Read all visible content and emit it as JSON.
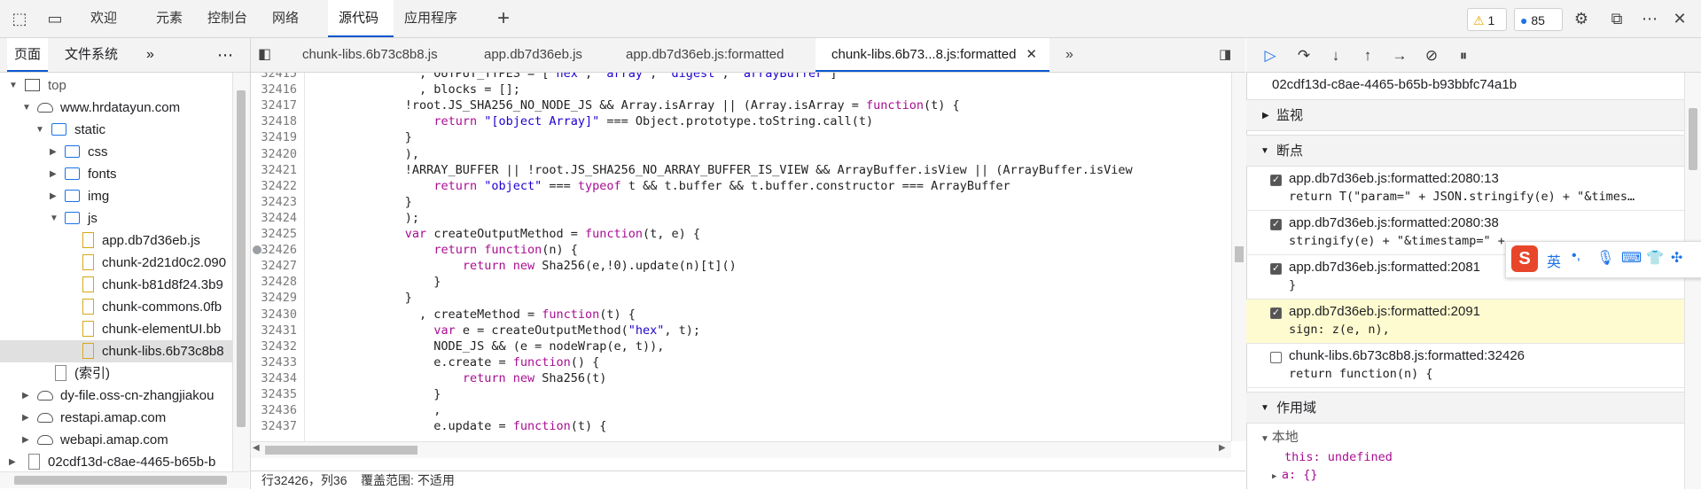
{
  "toolbar": {
    "tabs": [
      "欢迎",
      "元素",
      "控制台",
      "网络",
      "源代码",
      "应用程序"
    ],
    "active_tab": "源代码",
    "warnings_count": "1",
    "messages_count": "85"
  },
  "navigator": {
    "tabs": [
      "页面",
      "文件系统"
    ],
    "tree": [
      {
        "label": "top",
        "icon": "frame-icon"
      },
      {
        "label": "www.hrdatayun.com",
        "icon": "cloud-icon"
      },
      {
        "label": "static",
        "icon": "folder-icon"
      },
      {
        "label": "css",
        "icon": "folder-icon"
      },
      {
        "label": "fonts",
        "icon": "folder-icon"
      },
      {
        "label": "img",
        "icon": "folder-icon"
      },
      {
        "label": "js",
        "icon": "folder-icon"
      },
      {
        "label": "app.db7d36eb.js",
        "icon": "file-icon"
      },
      {
        "label": "chunk-2d21d0c2.090",
        "icon": "file-icon"
      },
      {
        "label": "chunk-b81d8f24.3b9",
        "icon": "file-icon"
      },
      {
        "label": "chunk-commons.0fb",
        "icon": "file-icon"
      },
      {
        "label": "chunk-elementUI.bb",
        "icon": "file-icon"
      },
      {
        "label": "chunk-libs.6b73c8b8",
        "icon": "file-icon"
      },
      {
        "label": "(索引)",
        "icon": "file-icon"
      },
      {
        "label": "dy-file.oss-cn-zhangjiakou",
        "icon": "cloud-icon"
      },
      {
        "label": "restapi.amap.com",
        "icon": "cloud-icon"
      },
      {
        "label": "webapi.amap.com",
        "icon": "cloud-icon"
      },
      {
        "label": "02cdf13d-c8ae-4465-b65b-b",
        "icon": "file-icon"
      }
    ]
  },
  "editor": {
    "tabs": [
      "chunk-libs.6b73c8b8.js",
      "app.db7d36eb.js",
      "app.db7d36eb.js:formatted",
      "chunk-libs.6b73...8.js:formatted"
    ],
    "active_tab": "chunk-libs.6b73...8.js:formatted",
    "lines": [
      {
        "n": "32415",
        "code": "                , OUTPUT_TYPES = [\"hex\", \"array\", \"digest\", \"arrayBuffer\"]"
      },
      {
        "n": "32416",
        "code": "                , blocks = [];"
      },
      {
        "n": "32417",
        "code": "              !root.JS_SHA256_NO_NODE_JS && Array.isArray || (Array.isArray = function(t) {"
      },
      {
        "n": "32418",
        "code": "                  return \"[object Array]\" === Object.prototype.toString.call(t)"
      },
      {
        "n": "32419",
        "code": "              }"
      },
      {
        "n": "32420",
        "code": "              ),"
      },
      {
        "n": "32421",
        "code": "              !ARRAY_BUFFER || !root.JS_SHA256_NO_ARRAY_BUFFER_IS_VIEW && ArrayBuffer.isView || (ArrayBuffer.isView"
      },
      {
        "n": "32422",
        "code": "                  return \"object\" === typeof t && t.buffer && t.buffer.constructor === ArrayBuffer"
      },
      {
        "n": "32423",
        "code": "              }"
      },
      {
        "n": "32424",
        "code": "              );"
      },
      {
        "n": "32425",
        "code": "              var createOutputMethod = function(t, e) {"
      },
      {
        "n": "32426",
        "code": "                  return function(n) {"
      },
      {
        "n": "32427",
        "code": "                      return new Sha256(e,!0).update(n)[t]()"
      },
      {
        "n": "32428",
        "code": "                  }"
      },
      {
        "n": "32429",
        "code": "              }"
      },
      {
        "n": "32430",
        "code": "                , createMethod = function(t) {"
      },
      {
        "n": "32431",
        "code": "                  var e = createOutputMethod(\"hex\", t);"
      },
      {
        "n": "32432",
        "code": "                  NODE_JS && (e = nodeWrap(e, t)),"
      },
      {
        "n": "32433",
        "code": "                  e.create = function() {"
      },
      {
        "n": "32434",
        "code": "                      return new Sha256(t)"
      },
      {
        "n": "32435",
        "code": "                  }"
      },
      {
        "n": "32436",
        "code": "                  ,"
      },
      {
        "n": "32437",
        "code": "                  e.update = function(t) {"
      }
    ],
    "status": "行32426，列36    覆盖范围: 不适用"
  },
  "debugger": {
    "thread_id": "02cdf13d-c8ae-4465-b65b-b93bbfc74a1b",
    "sections": {
      "watch": "监视",
      "breakpoints": "断点",
      "scope": "作用域",
      "local": "本地"
    },
    "breakpoints": [
      {
        "file": "app.db7d36eb.js:formatted:2080:13",
        "code": "return T(\"param=\" + JSON.stringify(e) + \"&times…",
        "checked": true,
        "hit": false
      },
      {
        "file": "app.db7d36eb.js:formatted:2080:38",
        "code": "stringify(e) + \"&timestamp=\" + ",
        "checked": true,
        "hit": false
      },
      {
        "file": "app.db7d36eb.js:formatted:2081",
        "code": "}",
        "checked": true,
        "hit": false
      },
      {
        "file": "app.db7d36eb.js:formatted:2091",
        "code": "sign: z(e, n),",
        "checked": true,
        "hit": true
      },
      {
        "file": "chunk-libs.6b73c8b8.js:formatted:32426",
        "code": "return function(n) {",
        "checked": false,
        "hit": false
      }
    ],
    "scope_this": "this: undefined",
    "scope_a": "a: {}"
  },
  "ime": {
    "lang": "英",
    "logo": "S"
  }
}
